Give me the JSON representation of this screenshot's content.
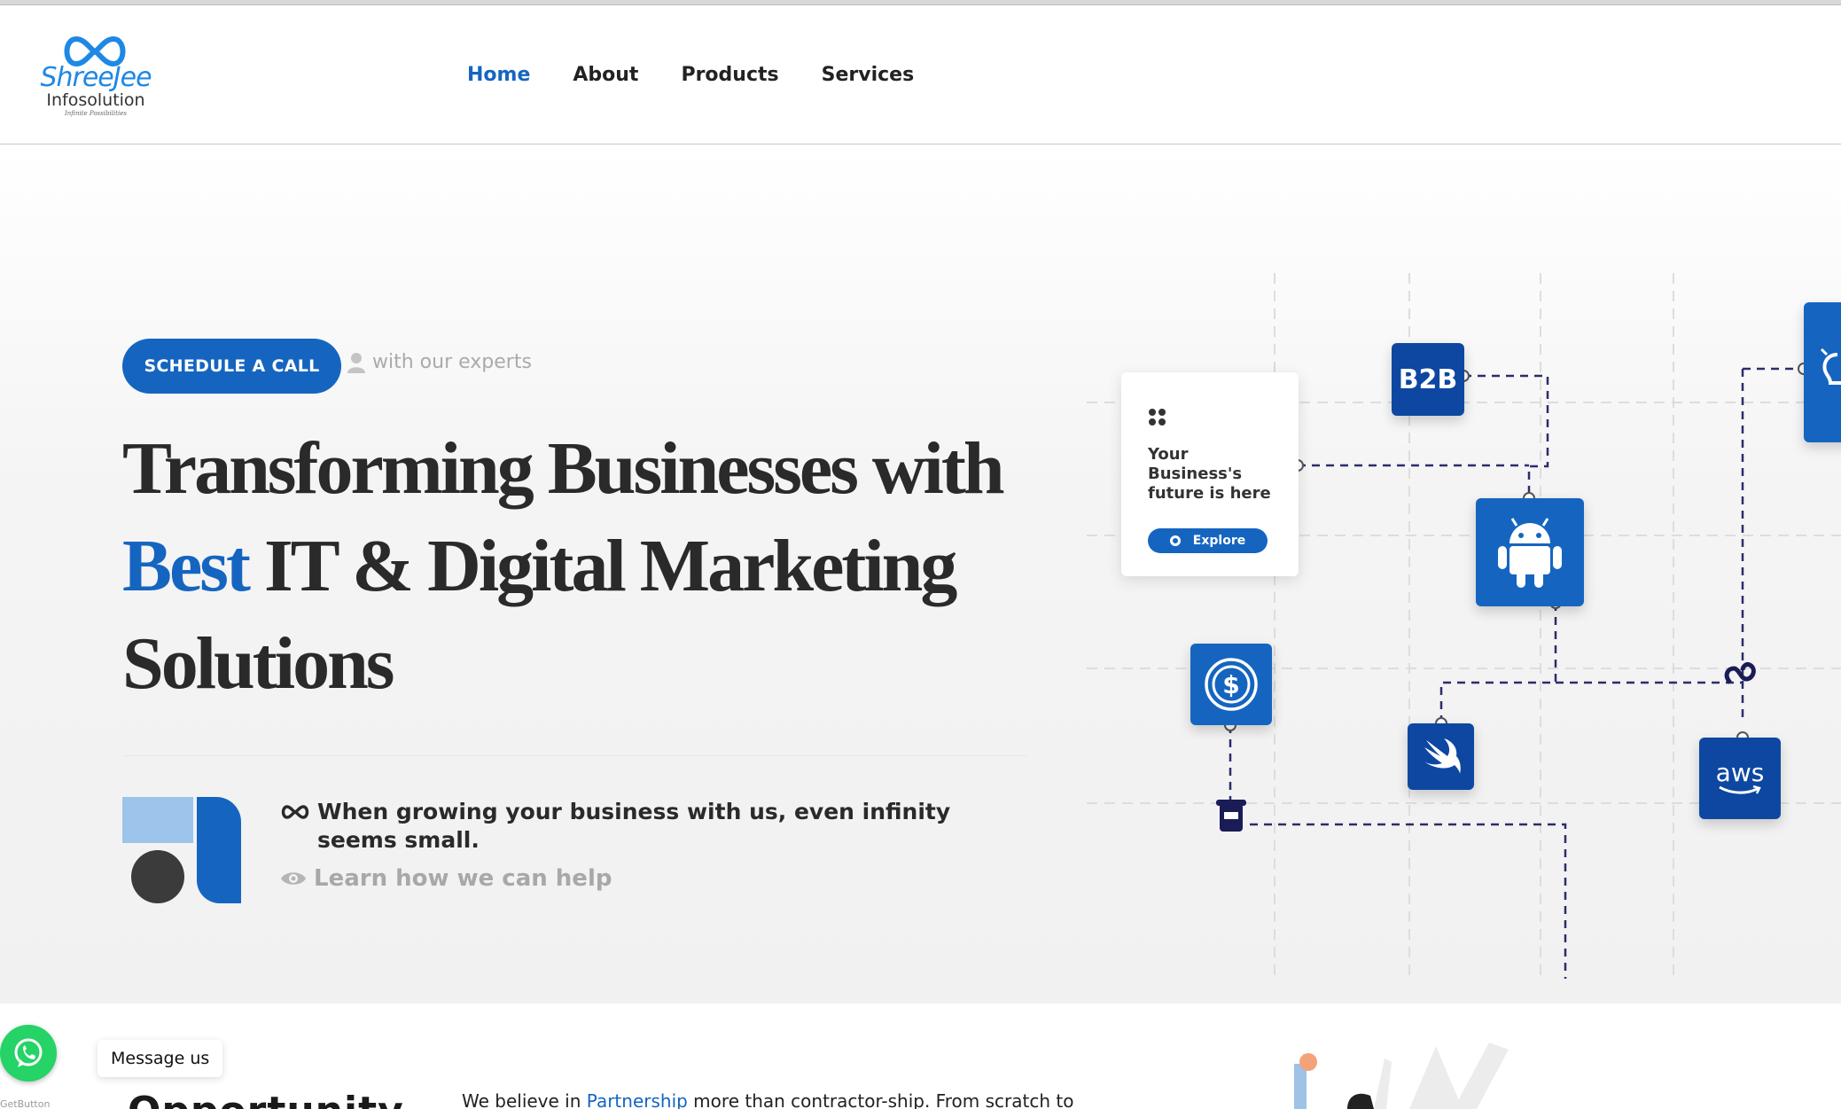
{
  "brand": {
    "name": "ShreeJee",
    "subname": "Infosolution",
    "tagline": "Infinite Possibilities",
    "primary_color": "#1565c0",
    "accent_color": "#1e88e5"
  },
  "nav": {
    "items": [
      {
        "label": "Home",
        "active": true
      },
      {
        "label": "About",
        "active": false
      },
      {
        "label": "Products",
        "active": false
      },
      {
        "label": "Services",
        "active": false
      }
    ]
  },
  "hero": {
    "cta_label": "SCHEDULE A CALL",
    "cta_note": "with our experts",
    "headline_line1": "Transforming Businesses with",
    "headline_highlight": "Best",
    "headline_line2_rest": " IT & Digital Marketing",
    "headline_line3": "Solutions",
    "claim": "When growing your business with us, even infinity seems small.",
    "learn_link": "Learn how we can help"
  },
  "diagram": {
    "card_text": "Your Business's future is here",
    "card_button": "Explore",
    "tiles": [
      {
        "label": "B2B",
        "icon": "b2b-icon"
      },
      {
        "label": "",
        "icon": "android-icon"
      },
      {
        "label": "",
        "icon": "dollar-coin-icon"
      },
      {
        "label": "",
        "icon": "swift-icon"
      },
      {
        "label": "aws",
        "icon": "aws-icon"
      },
      {
        "label": "",
        "icon": "lightbulb-icon"
      }
    ]
  },
  "bottom": {
    "section_title": "Opportunity",
    "intro_prefix": "We believe in ",
    "intro_highlight": "Partnership",
    "intro_suffix": " more than contractor-ship. From scratch to"
  },
  "widgets": {
    "whatsapp_label": "Message us",
    "getbutton": "GetButton"
  }
}
